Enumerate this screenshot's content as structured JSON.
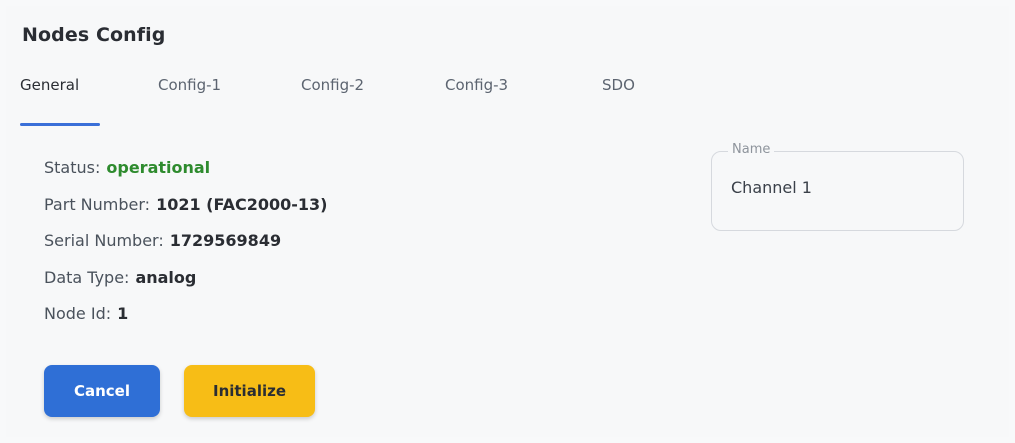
{
  "title": "Nodes Config",
  "tabs": [
    {
      "label": "General",
      "active": true
    },
    {
      "label": "Config-1",
      "active": false
    },
    {
      "label": "Config-2",
      "active": false
    },
    {
      "label": "Config-3",
      "active": false
    },
    {
      "label": "SDO",
      "active": false
    }
  ],
  "info": {
    "status_label": "Status:",
    "status_value": "operational",
    "part_label": "Part Number:",
    "part_value": "1021 (FAC2000-13)",
    "serial_label": "Serial Number:",
    "serial_value": "1729569849",
    "datatype_label": "Data Type:",
    "datatype_value": "analog",
    "nodeid_label": "Node Id:",
    "nodeid_value": "1"
  },
  "name_field": {
    "legend": "Name",
    "value": "Channel 1"
  },
  "buttons": {
    "cancel": "Cancel",
    "initialize": "Initialize"
  },
  "colors": {
    "accent": "#3a6fd8",
    "status_ok": "#2e8b2e",
    "cancel_bg": "#2f6fd6",
    "initialize_bg": "#f7bd16"
  }
}
